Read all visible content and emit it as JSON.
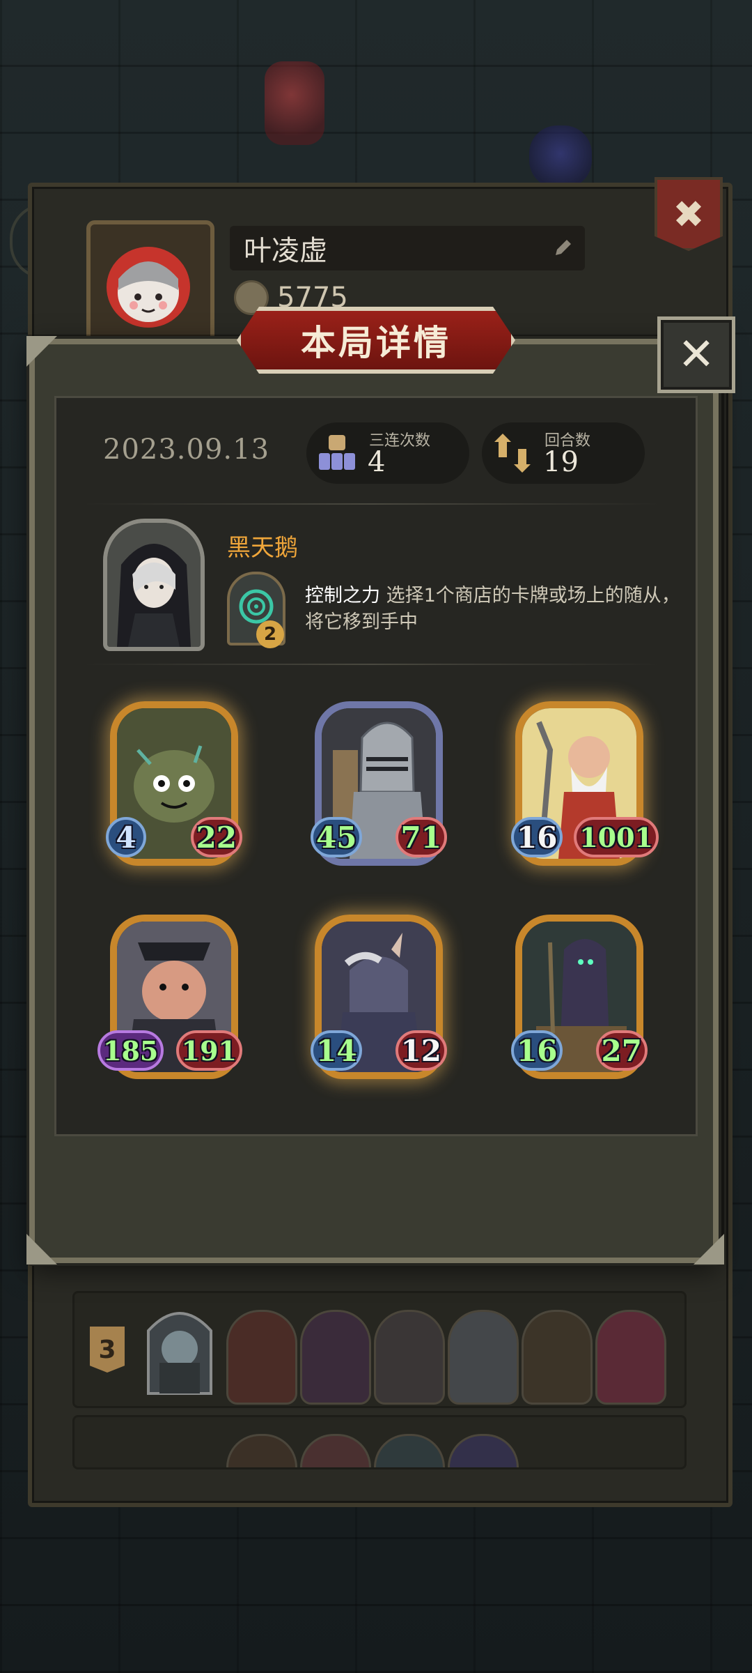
{
  "profile": {
    "player_name": "叶凌虚",
    "coins": "5775",
    "close_label": "✖"
  },
  "history": {
    "rows": [
      {
        "rank": "3"
      }
    ]
  },
  "detail_modal": {
    "title": "本局详情",
    "close_label": "✕",
    "date": "2023.09.13",
    "stats": [
      {
        "label": "三连次数",
        "value": "4",
        "icon": "triple-icon"
      },
      {
        "label": "回合数",
        "value": "19",
        "icon": "turns-icon"
      }
    ],
    "hero": {
      "name": "黑天鹅",
      "power_name": "控制之力",
      "power_desc": " 选择1个商店的卡牌或场上的随从，将它移到手中",
      "power_cost": "2"
    },
    "minions": [
      {
        "attack": "4",
        "health": "22",
        "tier": "gold",
        "icon": "rock-golem-icon"
      },
      {
        "attack": "45",
        "health": "71",
        "tier": "silver",
        "icon": "armored-knight-icon"
      },
      {
        "attack": "16",
        "health": "1001",
        "tier": "gold",
        "icon": "old-warrior-icon"
      },
      {
        "attack": "185",
        "health": "191",
        "tier": "bronze",
        "icon": "pirate-brute-icon"
      },
      {
        "attack": "14",
        "health": "12",
        "tier": "gold",
        "icon": "horned-beast-icon"
      },
      {
        "attack": "16",
        "health": "27",
        "tier": "bronze",
        "icon": "hooded-reaper-icon"
      }
    ]
  },
  "colors": {
    "accent_gold": "#f0a63a",
    "banner_red": "#8a1c16",
    "attack_green": "#a8ff8d"
  }
}
